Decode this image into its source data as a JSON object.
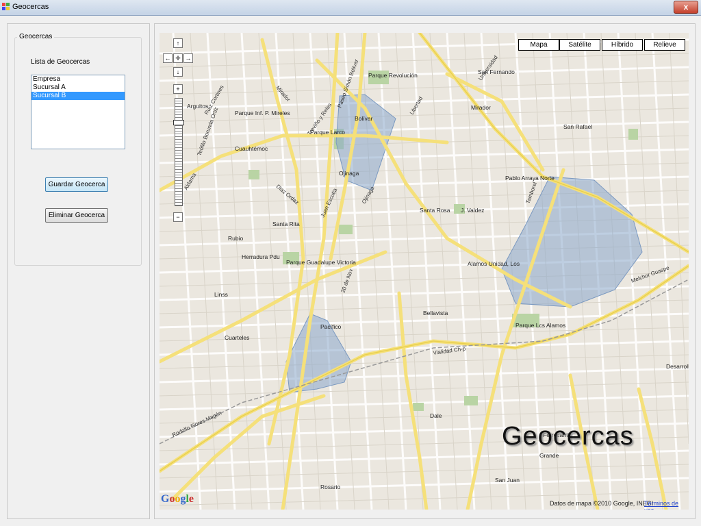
{
  "window": {
    "title": "Geocercas",
    "close_label": "x"
  },
  "panel": {
    "group_title": "Geocercas",
    "list_label": "Lista de Geocercas",
    "list_items": [
      "Empresa",
      "Sucursal A",
      "Sucursal B"
    ],
    "selected_index": 2,
    "save_button": "Guardar Geocerca",
    "delete_button": "Eliminar Geocerca"
  },
  "map": {
    "map_types": [
      "Mapa",
      "Satélite",
      "Híbrido",
      "Relieve"
    ],
    "watermark": "Geocercas",
    "copyright": "Datos de mapa ©2010 Google, INEGI",
    "terms": "Términos de uso",
    "logo": "Google",
    "place_labels": [
      "Bolívar",
      "Parque Revolución",
      "Parque Larco",
      "Ojinaga",
      "Santa Rosa",
      "Pablo Arraya Norte",
      "San Rafael",
      "Parque Lcs Alamos",
      "Pacífico",
      "Cuarteles",
      "Rubio",
      "Santa Rita",
      "Parque Guadalupe Victoria",
      "Bellavista",
      "Alamos Unidad, Los",
      "Dale",
      "Rosario",
      "San Juan",
      "Grande",
      "Cuauhtémoc",
      "Parque Inf. P. Mireles",
      "Arguitos",
      "Herradura Pdu",
      "Linss",
      "J. Valdez",
      "Mirador",
      "San Fernando",
      "Ferrocarril",
      "Desarrollo Urbano"
    ],
    "street_labels": [
      "Universidad",
      "Tamborel",
      "Melchor Guaspe",
      "Vialidad Ch-p",
      "Paseo Simón Bolívar",
      "Treviño y Reles",
      "20 de Nov",
      "Diaz Ordaz",
      "Ruiz Cortines",
      "Aldama",
      "Teófilo Borunda Ortiz",
      "Rodolfo Flores Magón",
      "Juan Escutia",
      "Ojinaga",
      "Libertad",
      "Mirador"
    ]
  }
}
